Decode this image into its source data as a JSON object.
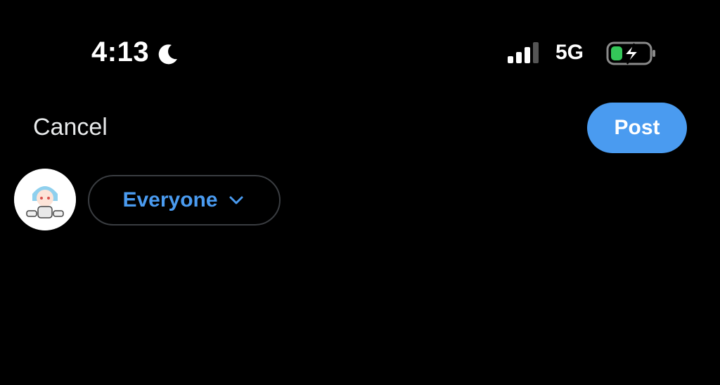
{
  "status_bar": {
    "time": "4:13",
    "network": "5G",
    "icons": [
      "moon-icon",
      "signal-icon",
      "battery-charging-icon"
    ]
  },
  "header": {
    "cancel_label": "Cancel",
    "post_label": "Post"
  },
  "composer": {
    "audience_label": "Everyone",
    "draft_text": ""
  },
  "colors": {
    "background": "#000000",
    "accent": "#4a9bf0",
    "text": "#e7e9ea",
    "pill_border": "#3a3d41",
    "battery_fill": "#34c759"
  }
}
